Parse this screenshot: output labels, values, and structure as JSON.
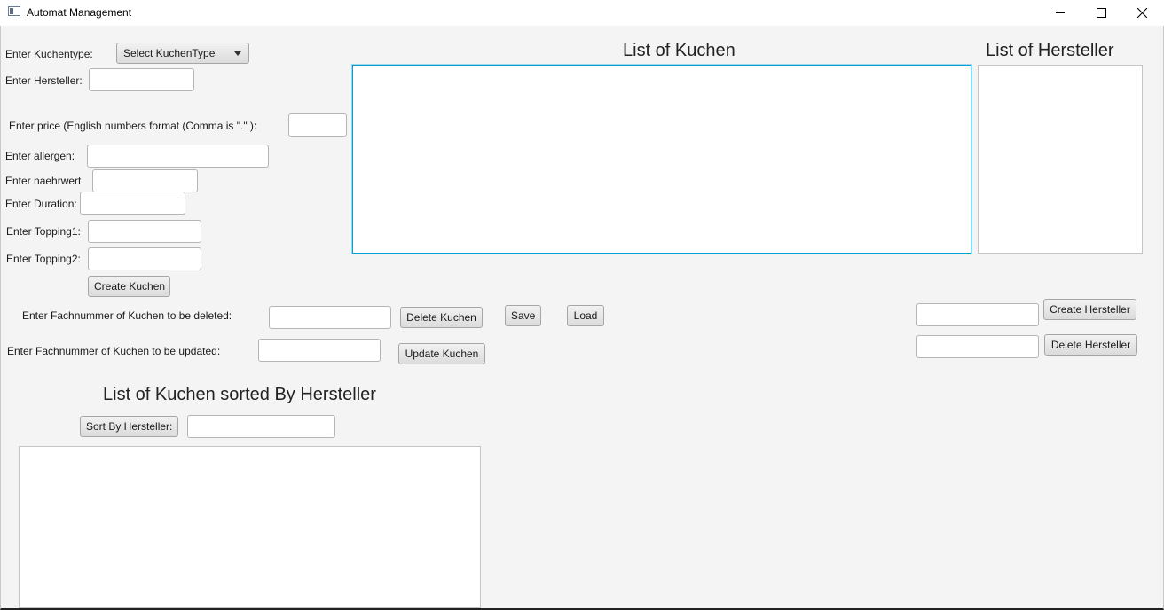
{
  "window": {
    "title": "Automat Management",
    "icons": {
      "app": "app-window-icon",
      "minimize": "minimize-icon",
      "maximize": "maximize-icon",
      "close": "close-icon"
    }
  },
  "form": {
    "kuchentype_label": "Enter Kuchentype:",
    "kuchentype_select": "Select KuchenType",
    "hersteller_label": "Enter Hersteller:",
    "price_label": "Enter price (English numbers format  (Comma is \".\"  ):",
    "allergen_label": "Enter allergen:",
    "naehrwert_label": "Enter naehrwert",
    "duration_label": "Enter Duration:",
    "topping1_label": "Enter Topping1:",
    "topping2_label": "Enter Topping2:",
    "create_kuchen_button": "Create Kuchen"
  },
  "actions": {
    "delete_label": "Enter Fachnummer of Kuchen to be deleted:",
    "delete_button": "Delete Kuchen",
    "update_label": "Enter Fachnummer of Kuchen to be updated:",
    "update_button": "Update Kuchen",
    "save_button": "Save",
    "load_button": "Load"
  },
  "kuchen_list": {
    "heading": "List of Kuchen"
  },
  "hersteller_list": {
    "heading": "List of Hersteller",
    "create_button": "Create Hersteller",
    "delete_button": "Delete Hersteller"
  },
  "sorted_list": {
    "heading": "List of Kuchen sorted By Hersteller",
    "sort_button": "Sort By Hersteller:"
  }
}
